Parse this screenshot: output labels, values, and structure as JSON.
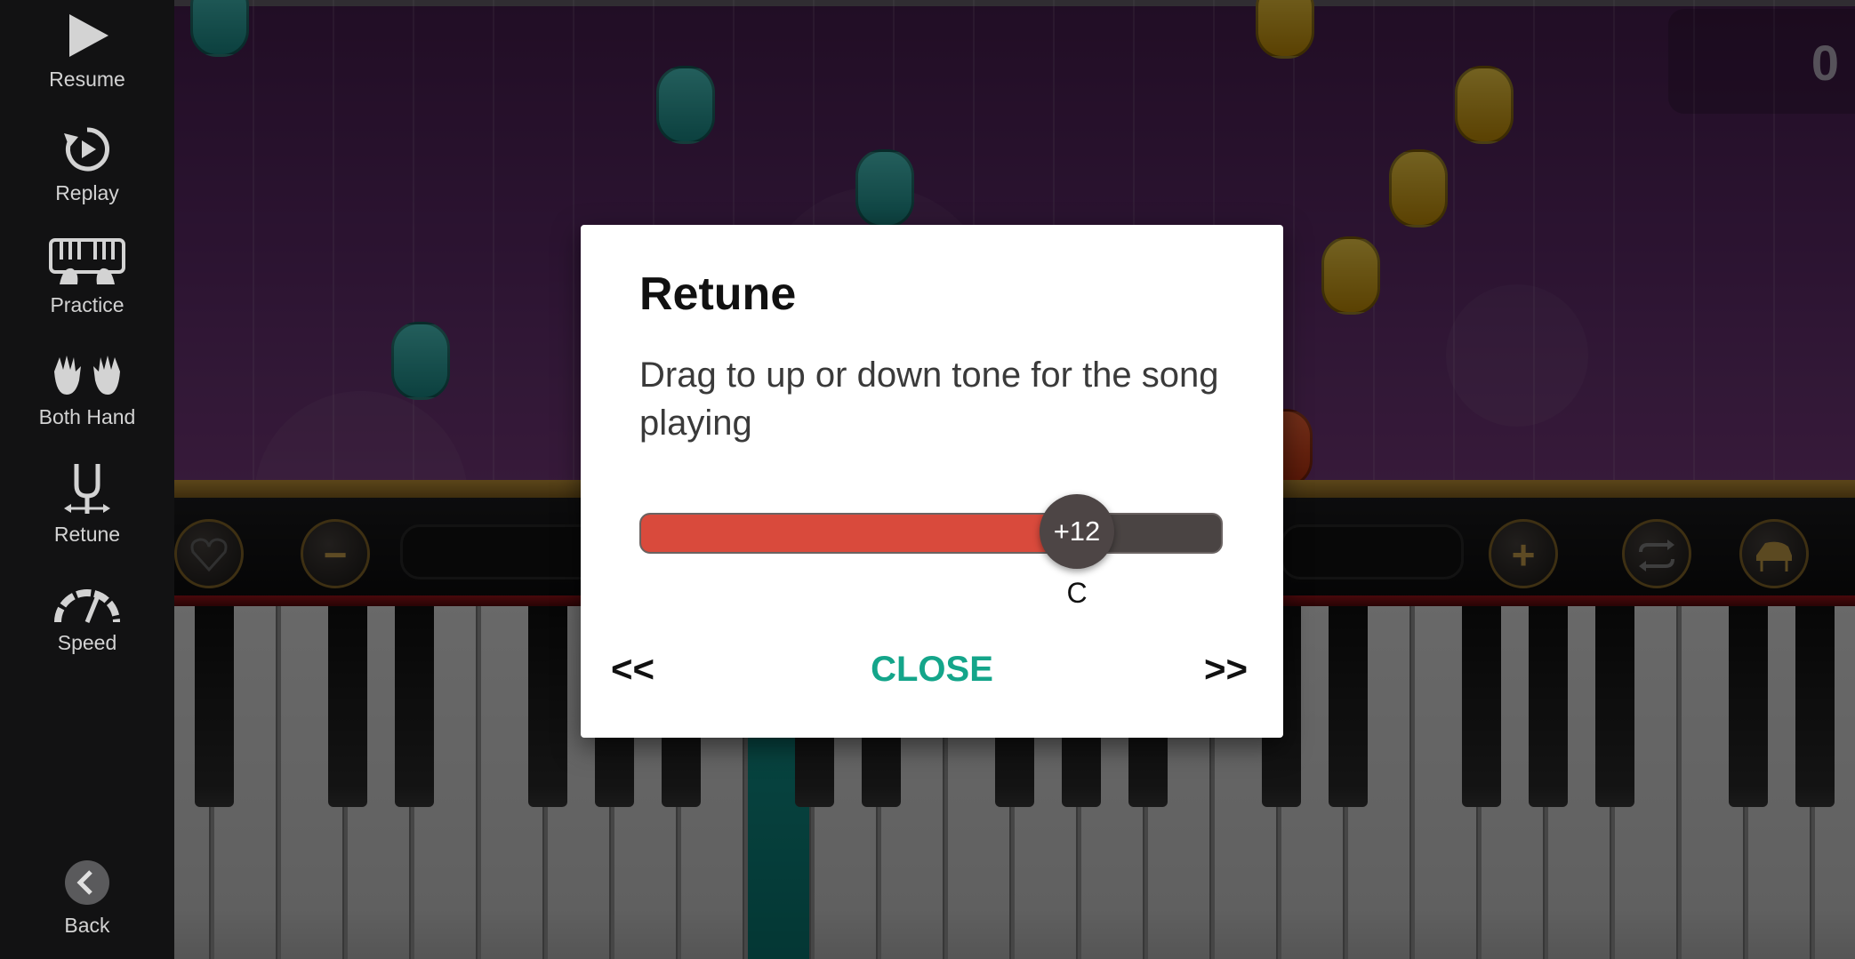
{
  "sidebar": {
    "items": [
      {
        "label": "Resume",
        "icon": "play-icon"
      },
      {
        "label": "Replay",
        "icon": "replay-icon"
      },
      {
        "label": "Practice",
        "icon": "piano-hands-icon"
      },
      {
        "label": "Both Hand",
        "icon": "both-hands-icon"
      },
      {
        "label": "Retune",
        "icon": "tuning-fork-icon"
      },
      {
        "label": "Speed",
        "icon": "speedometer-icon"
      }
    ],
    "back_label": "Back"
  },
  "game": {
    "score": "0"
  },
  "dialog": {
    "title": "Retune",
    "message": "Drag to up or down tone for the song playing",
    "slider_value": "+12",
    "slider_fraction": 0.75,
    "note_name": "C",
    "prev_label": "<<",
    "close_label": "CLOSE",
    "next_label": ">>"
  },
  "colors": {
    "accent": "#14a58a",
    "slider_fill": "#d94a3c",
    "slider_track": "#4a4443"
  }
}
